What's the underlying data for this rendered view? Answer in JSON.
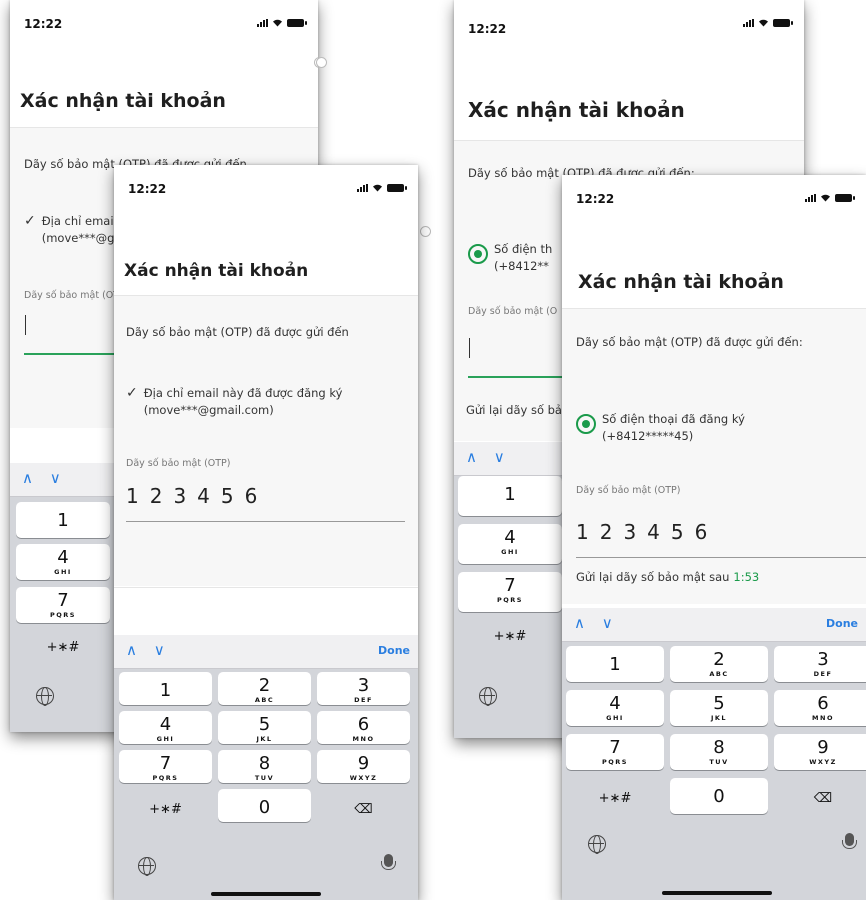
{
  "status": {
    "time": "12:22"
  },
  "screen": {
    "title": "Xác nhận tài khoản",
    "otp_sent_to": "Dãy số bảo mật (OTP) đã được gửi đến",
    "otp_sent_to_colon": "Dãy số bảo mật (OTP) đã được gửi đến:",
    "email_line1": "Địa chỉ email này đã được đăng ký",
    "email_line2": "(move***@gmail.com)",
    "phone_line1": "Số điện thoại đã đăng ký",
    "phone_line2": "(+8412*****45)",
    "otp_label": "Dãy số bảo mật (OTP)",
    "otp_value": "123456",
    "resend_label": "Gửi lại dãy số bảo mật sau",
    "resend_timer": "1:53"
  },
  "partial": {
    "a_email_line1": "Địa chỉ email",
    "a_email_line2": "(move***@g",
    "a_otp_label": "Dãy số bảo mật (OT",
    "c_otp_sent": "Dãy số bảo mật (OTP) đã được gửi đến:",
    "c_phone_line1": "Số điện th",
    "c_phone_line2": "(+8412**",
    "c_otp_label": "Dãy số bảo mật (O",
    "c_resend": "Gửi lại dãy số bả"
  },
  "keyboard": {
    "arrows": "∧ ∨",
    "done": "Done",
    "keys": [
      {
        "num": "1",
        "letters": ""
      },
      {
        "num": "2",
        "letters": "ABC"
      },
      {
        "num": "3",
        "letters": "DEF"
      },
      {
        "num": "4",
        "letters": "GHI"
      },
      {
        "num": "5",
        "letters": "JKL"
      },
      {
        "num": "6",
        "letters": "MNO"
      },
      {
        "num": "7",
        "letters": "PQRS"
      },
      {
        "num": "8",
        "letters": "TUV"
      },
      {
        "num": "9",
        "letters": "WXYZ"
      },
      {
        "num": "0",
        "letters": ""
      }
    ],
    "symbols": "+∗#",
    "backspace": "⌫"
  },
  "icons": {
    "check": "✓",
    "accent": "#1a9a4a",
    "link": "#2a7ee0"
  }
}
